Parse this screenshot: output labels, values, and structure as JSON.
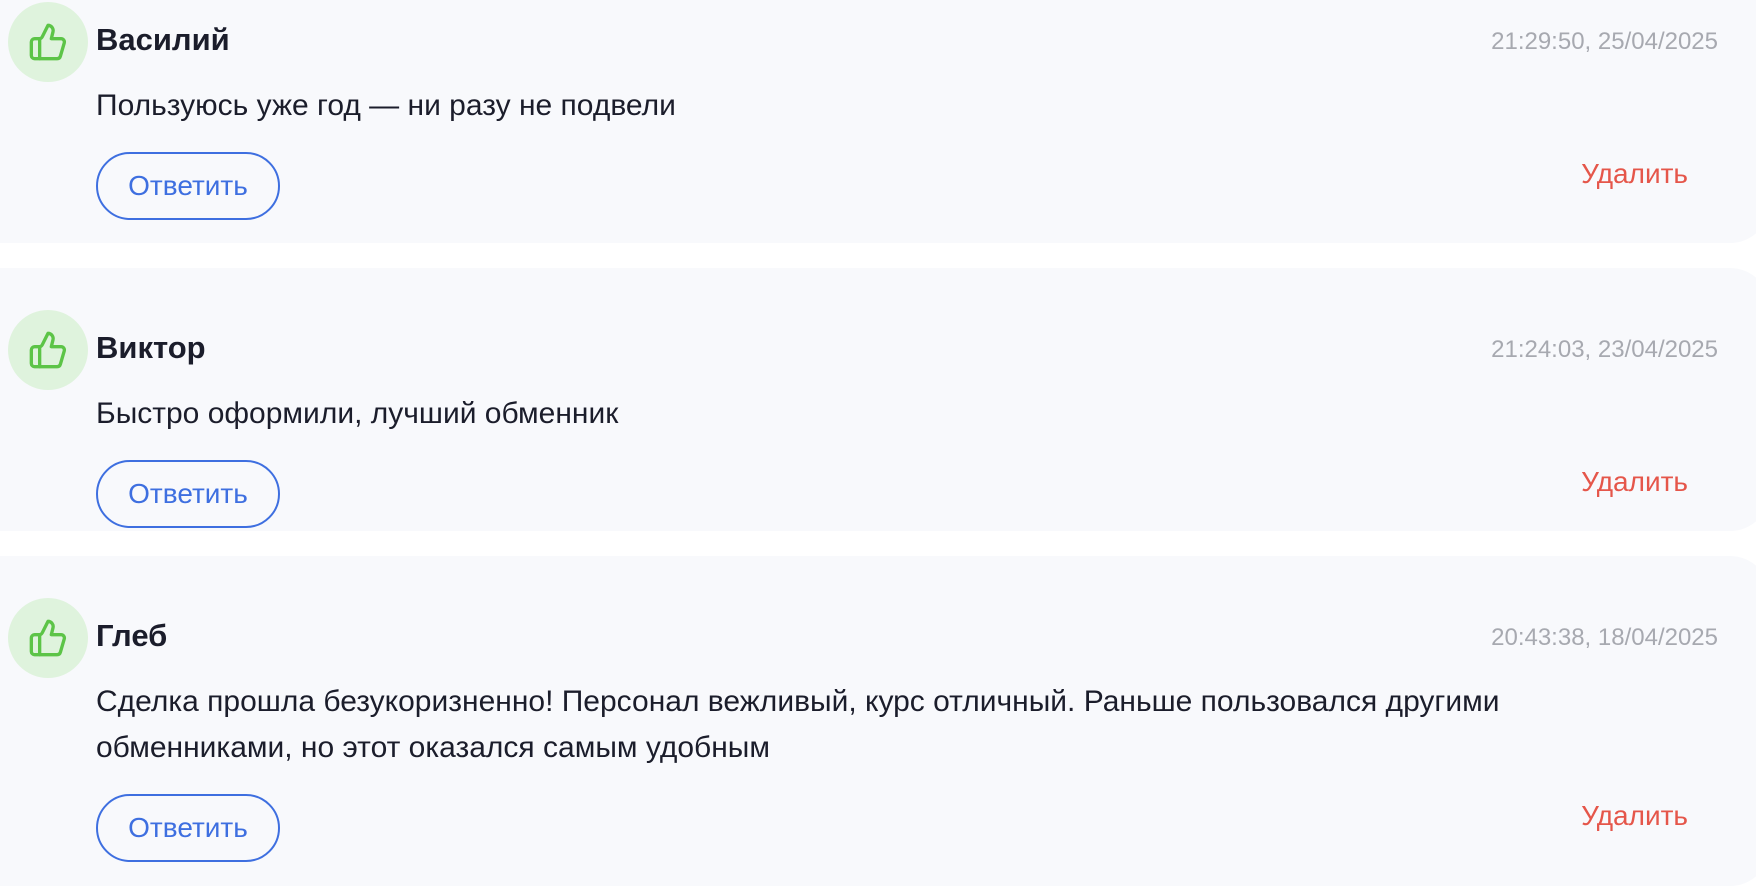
{
  "colors": {
    "accent": "#3e6fe0",
    "danger": "#e5564a",
    "like_icon": "#5cc447",
    "like_bg": "#dff3dd",
    "card_bg": "#f8f9fc"
  },
  "reviews": [
    {
      "icon": "thumbs-up-icon",
      "author": "Василий",
      "datetime": "21:29:50, 25/04/2025",
      "text": "Пользуюсь уже год — ни разу не подвели",
      "reply_label": "Ответить",
      "delete_label": "Удалить"
    },
    {
      "icon": "thumbs-up-icon",
      "author": "Виктор",
      "datetime": "21:24:03, 23/04/2025",
      "text": "Быстро оформили, лучший обменник",
      "reply_label": "Ответить",
      "delete_label": "Удалить"
    },
    {
      "icon": "thumbs-up-icon",
      "author": "Глеб",
      "datetime": "20:43:38, 18/04/2025",
      "text": "Сделка прошла безукоризненно! Персонал вежливый, курс отличный. Раньше пользовался другими обменниками, но этот оказался самым удобным",
      "reply_label": "Ответить",
      "delete_label": "Удалить"
    }
  ]
}
